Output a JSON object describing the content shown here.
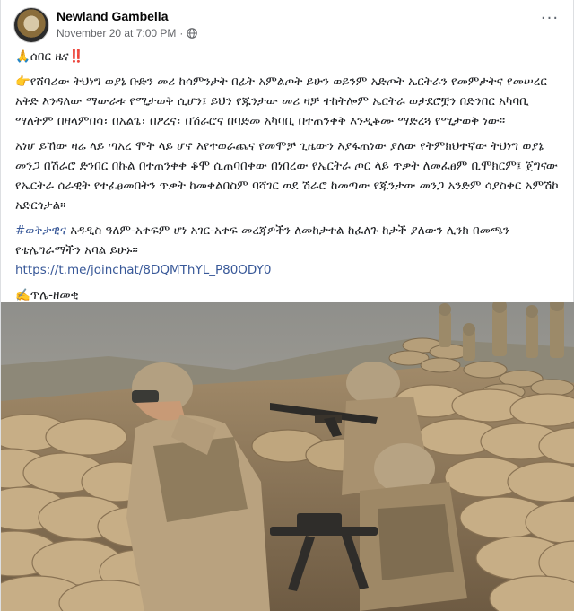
{
  "post": {
    "author": "Newland Gambella",
    "timestamp": "November 20 at 7:00 PM",
    "separator": "·",
    "more_label": "···"
  },
  "content": {
    "breaking": "🙏ሰበር ዜና‼️",
    "para1": "👉የሸባሪው ትህነግ ወያኔ ቡድን መሪ ከሳምንታት በፊት አምልጦት ይሁን ወይንም አድጦት ኤርትራን የመምታትና የመሠረር አቅድ እንዳለው ማውራቱ የሚታወቅ ሲሆን፤ ይህን የጁንታው መሪ ዛቻ ተከትሎም ኤርትራ ወታደሮቿን በድንበር አካባቢ ማለትም በዛላምበሳ፣ በአልጌ፣ በፆረና፣ በሽራሮና በባድመ አካባቢ በተጠንቀቅ እንዲቆሙ ማድረጓ የሚታወቅ ነው።",
    "para2": "አነሆ ይኸው ዛሬ ላይ ጣአረ ሞት ላይ ሆኖ እየተወራጨና የመሞቻ ጊዜውን እያፋጠነው ያለው የትምክህተኛው ትህነግ ወያኔ መንጋ በሽራሮ ድንበር በኩል በተጠንቀቀ ቆሞ ሲጠባበቀው በነበረው የኤርትራ ጦር ላይ ጥቃት ለመፈፀም ቢሞክርም፤ ጀግናው የኤርትራ ሰራዊት የተፈፀመበትን ጥቃት ከመቀልበስም ባሻገር ወደ ሽራሮ ከመጣው የጁንታው መንጋ አንድም ሳያስቀር አምሽኮ አድርጎታል።",
    "hashtag": "#ወቅታዊና",
    "para3_rest": " አዳዲስ ዓለም-አቀፍም ሆነ አገር-አቀፍ መረጃዎችን ለመከታተል ከፈለጉ ከታች ያለውን ሊንክ በመጫን የቴሌግራማችን አባል ይሁኑ።",
    "link": "https://t.me/joinchat/8DQMThYL_P80ODY0",
    "signature": "✍️ጥሌ-ዘመቂ"
  },
  "photo": {
    "subject": "soldiers-behind-sandbags"
  },
  "colors": {
    "link": "#385898",
    "meta": "#65676b",
    "text": "#1c1e21"
  }
}
